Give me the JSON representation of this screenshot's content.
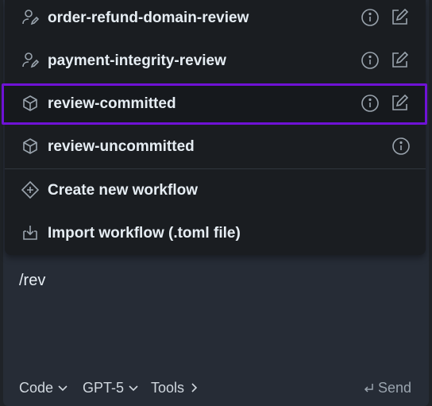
{
  "menu": {
    "items": [
      {
        "label": "order-refund-domain-review",
        "lead_icon": "user-edit-icon",
        "info": true,
        "edit": true
      },
      {
        "label": "payment-integrity-review",
        "lead_icon": "user-edit-icon",
        "info": true,
        "edit": true
      },
      {
        "label": "review-committed",
        "lead_icon": "cube-icon",
        "info": true,
        "edit": true,
        "selected": true
      },
      {
        "label": "review-uncommitted",
        "lead_icon": "cube-icon",
        "info": true,
        "edit": false
      }
    ],
    "actions": [
      {
        "label": "Create new workflow",
        "icon": "diamond-plus-icon"
      },
      {
        "label": "Import workflow (.toml file)",
        "icon": "import-icon"
      }
    ]
  },
  "composer": {
    "input_value": "/rev",
    "mode_label": "Code",
    "model_label": "GPT-5",
    "tools_label": "Tools",
    "send_label": "Send"
  },
  "colors": {
    "selection_border": "#6f12d6",
    "menu_bg": "#1a1d21",
    "composer_bg": "#262c36"
  }
}
